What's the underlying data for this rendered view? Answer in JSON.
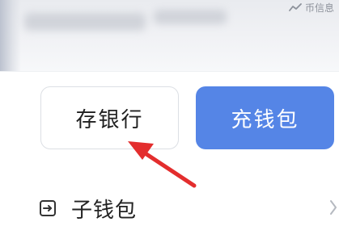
{
  "header": {
    "coin_info_label": "币信息",
    "coin_info_icon": "trend-line-icon"
  },
  "actions": {
    "deposit_bank_label": "存银行",
    "recharge_wallet_label": "充钱包"
  },
  "menu": {
    "sub_wallet_label": "子钱包",
    "sub_wallet_icon": "wallet-transfer-icon",
    "chevron_icon": "chevron-right-icon"
  },
  "colors": {
    "primary_button": "#5585e6",
    "annotation_arrow": "#e32d2d"
  }
}
